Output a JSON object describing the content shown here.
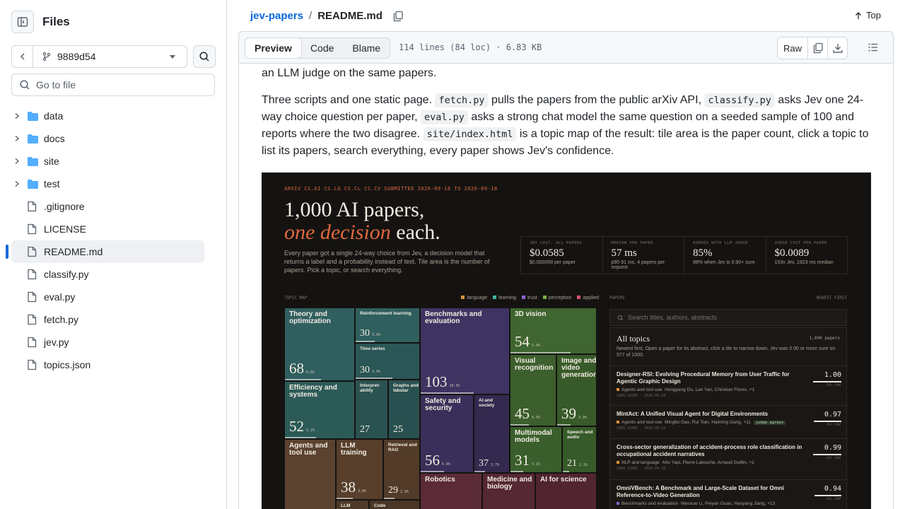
{
  "sidebar": {
    "title": "Files",
    "branch": "9889d54",
    "goto_placeholder": "Go to file",
    "items": [
      {
        "label": "data",
        "type": "folder"
      },
      {
        "label": "docs",
        "type": "folder"
      },
      {
        "label": "site",
        "type": "folder"
      },
      {
        "label": "test",
        "type": "folder"
      },
      {
        "label": ".gitignore",
        "type": "file"
      },
      {
        "label": "LICENSE",
        "type": "file"
      },
      {
        "label": "README.md",
        "type": "file",
        "active": true
      },
      {
        "label": "classify.py",
        "type": "file"
      },
      {
        "label": "eval.py",
        "type": "file"
      },
      {
        "label": "fetch.py",
        "type": "file"
      },
      {
        "label": "jev.py",
        "type": "file"
      },
      {
        "label": "topics.json",
        "type": "file"
      }
    ]
  },
  "header": {
    "repo": "jev-papers",
    "sep": "/",
    "file": "README.md",
    "top": "Top"
  },
  "filebar": {
    "tabs": [
      "Preview",
      "Code",
      "Blame"
    ],
    "meta": "114 lines (84 loc) · 6.83 KB",
    "raw": "Raw"
  },
  "readme": {
    "p1": "an LLM judge on the same papers.",
    "p2": [
      "Three scripts and one static page. ",
      "fetch.py",
      " pulls the papers from the public arXiv API, ",
      "classify.py",
      " asks Jev one 24-way choice question per paper, ",
      "eval.py",
      " asks a strong chat model the same question on a seeded sample of 100 and reports where the two disagree. ",
      "site/index.html",
      " is a topic map of the result: tile area is the paper count, click a topic to list its papers, search everything, every paper shows Jev's confidence."
    ]
  },
  "embedded": {
    "eyebrow": "ARXIV CS.AI CS.LG CS.CL CS.CV  SUBMITTED 2026-09-16 TO 2026-09-18",
    "hero1": "1,000 AI papers,",
    "hero2a": "one decision",
    "hero2b": " each.",
    "lede": "Every paper got a single 24-way choice from Jev, a decision model that returns a label and a probability instead of text. Tile area is the number of papers. Pick a topic, or search everything.",
    "stats": [
      {
        "k": "JEV COST, ALL PAPERS",
        "v": "$0.0585",
        "s": "$0.000058 per paper"
      },
      {
        "k": "MEDIAN PER PAPER",
        "v": "57 ms",
        "s": "p95 91 ms, 4 papers per request"
      },
      {
        "k": "AGREES WITH LLM JUDGE",
        "v": "85%",
        "s": "98% when Jev is 0.90+ sure"
      },
      {
        "k": "JUDGE COST PER PAPER",
        "v": "$0.0089",
        "s": "153x Jev, 1923 ms median"
      }
    ],
    "topic_map": "TOPIC MAP",
    "legend": [
      {
        "label": "language",
        "color": "#d9913a"
      },
      {
        "label": "learning",
        "color": "#3fb7a6"
      },
      {
        "label": "trust",
        "color": "#8a63d2"
      },
      {
        "label": "perception",
        "color": "#7cb342"
      },
      {
        "label": "applied",
        "color": "#d9506a"
      }
    ],
    "tiles": [
      {
        "t": "Theory and optimization",
        "n": "68",
        "p": "6.8%"
      },
      {
        "t": "Reinforcement learning",
        "n": "30",
        "p": "3.0%"
      },
      {
        "t": "Time series",
        "n": "30",
        "p": "3.0%"
      },
      {
        "t": "Efficiency and systems",
        "n": "52",
        "p": "5.2%"
      },
      {
        "t": "Interpret-ability",
        "n": "27",
        "p": ""
      },
      {
        "t": "Graphs and tabular",
        "n": "25",
        "p": ""
      },
      {
        "t": "Benchmarks and evaluation",
        "n": "103",
        "p": "10.3%"
      },
      {
        "t": "Safety and security",
        "n": "56",
        "p": "5.6%"
      },
      {
        "t": "AI and society",
        "n": "37",
        "p": "3.7%"
      },
      {
        "t": "3D vision",
        "n": "54",
        "p": "5.4%"
      },
      {
        "t": "Visual recognition",
        "n": "45",
        "p": "4.5%"
      },
      {
        "t": "Image and video generation",
        "n": "39",
        "p": "3.9%"
      },
      {
        "t": "Multimodal models",
        "n": "31",
        "p": "3.1%"
      },
      {
        "t": "Speech and audio",
        "n": "21",
        "p": "2.1%"
      },
      {
        "t": "Agents and tool use",
        "n": "",
        "p": ""
      },
      {
        "t": "LLM training",
        "n": "38",
        "p": "3.8%"
      },
      {
        "t": "Retrieval and RAG",
        "n": "29",
        "p": "2.9%"
      },
      {
        "t": "LLM",
        "n": "",
        "p": ""
      },
      {
        "t": "Code",
        "n": "",
        "p": ""
      },
      {
        "t": "Robotics",
        "n": "",
        "p": ""
      },
      {
        "t": "Medicine and biology",
        "n": "",
        "p": ""
      },
      {
        "t": "AI for science",
        "n": "",
        "p": ""
      }
    ],
    "papers_label": "PAPERS",
    "newest": "NEWEST FIRST",
    "search_placeholder": "Search titles, authors, abstracts",
    "all_topics": "All topics",
    "all_count": "1,000 papers",
    "all_desc": "Newest first. Open a paper for its abstract, click a tile to narrow down. Jev was 0.90 or more sure on 577 of 1000.",
    "conf_label": "JEV CONF",
    "papers": [
      {
        "title": "Designer-RSI: Evolving Procedural Memory from User Traffic for Agentic Graphic Design",
        "cat": "Agents and tool use",
        "color": "#d9913a",
        "authors": "Hongyang Du, Lan Yan, Christian Flores, +1",
        "tag": "",
        "date": "2609.22086 · 2026-09-18",
        "score": "1.00",
        "conf": 1.0
      },
      {
        "title": "MintAct: A Unified Visual Agent for Digital Environments",
        "cat": "Agents and tool use",
        "color": "#d9913a",
        "authors": "Mingfei Gao, Rui Tian, Haiming Gang, +11",
        "tag": "judge agrees",
        "date": "2609.22083 · 2026-09-18",
        "score": "0.97",
        "conf": 0.97
      },
      {
        "title": "Cross-sector generalization of accident-process role classification in occupational accident narratives",
        "cat": "NLP and language",
        "color": "#d9913a",
        "authors": "Aho Yapi, Pierre Latouche, Arnaud Guillin, +1",
        "tag": "",
        "date": "2609.22081 · 2026-09-18",
        "score": "0.99",
        "conf": 0.99
      },
      {
        "title": "OmniVBench: A Benchmark and Large-Scale Dataset for Omni Reference-to-Video Generation",
        "cat": "Benchmarks and evaluation",
        "color": "#8a63d2",
        "authors": "Wenxue Li, Peiyan Guan, Haoyang Jiang, +13",
        "tag": "",
        "date": "",
        "score": "0.94",
        "conf": 0.94
      }
    ]
  }
}
